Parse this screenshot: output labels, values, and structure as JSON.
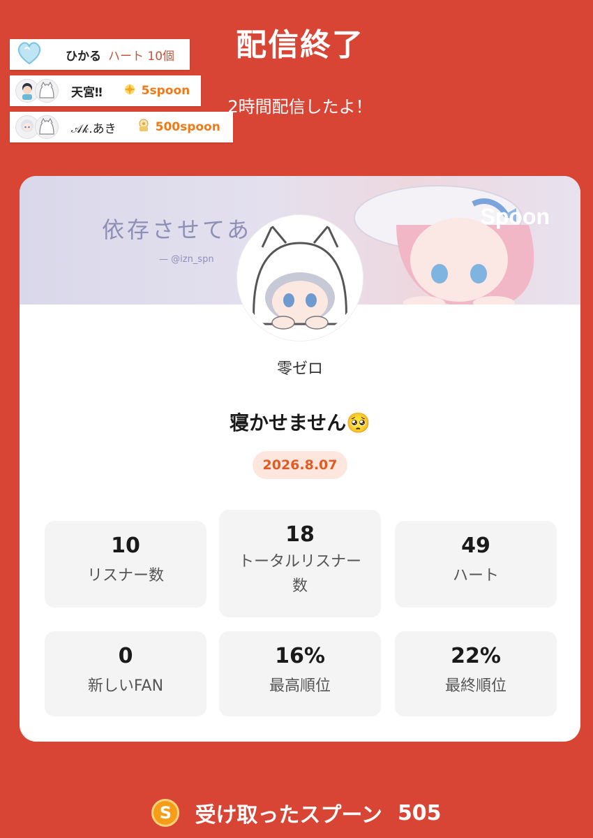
{
  "header": {
    "title": "配信終了",
    "subtitle": "2時間配信したよ！"
  },
  "notifications": [
    {
      "name": "ひかる",
      "gift": "ハート 10個",
      "icon": "blue-heart-icon"
    },
    {
      "name": "天宮‼︎",
      "gift": "5spoon",
      "icon": "spoon-gift-icon"
    },
    {
      "name": "𝒜𝓀.あき",
      "gift": "500spoon",
      "icon": "spoon-gift-icon"
    }
  ],
  "card": {
    "banner_text": "依存させてあ",
    "banner_handle": "— @izn_spn",
    "brand": "Spoon",
    "username": "零ゼロ",
    "live_title": "寝かせません🥺",
    "date": "2026.8.07",
    "stats": [
      {
        "value": "10",
        "label": "リスナー数"
      },
      {
        "value": "18",
        "label": "トータルリスナー数"
      },
      {
        "value": "49",
        "label": "ハート"
      },
      {
        "value": "0",
        "label": "新しいFAN"
      },
      {
        "value": "16%",
        "label": "最高順位"
      },
      {
        "value": "22%",
        "label": "最終順位"
      }
    ]
  },
  "footer": {
    "coin_letter": "S",
    "label": "受け取ったスプーン",
    "count": "505"
  },
  "colors": {
    "background": "#d94535",
    "date_badge_bg": "#fde6dd",
    "date_badge_text": "#e05a22",
    "spoon_text": "#ef7a1a"
  }
}
